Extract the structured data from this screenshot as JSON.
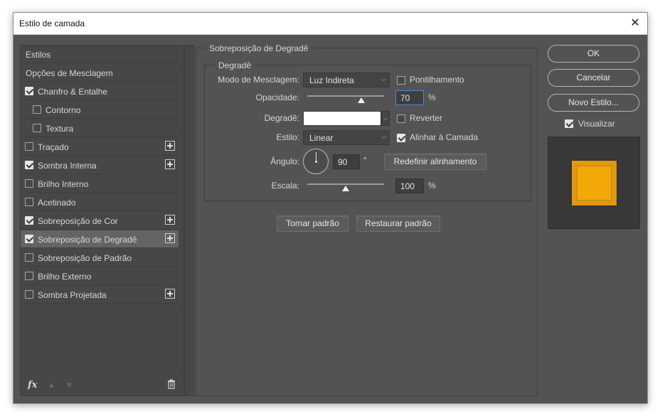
{
  "window": {
    "title": "Estilo de camada",
    "close_icon": "close-icon"
  },
  "sidebar": {
    "items": [
      {
        "label": "Estilos",
        "checkbox": null,
        "checked": false,
        "plus": false,
        "indent": false,
        "selected": false
      },
      {
        "label": "Opções de Mesclagem",
        "checkbox": null,
        "checked": false,
        "plus": false,
        "indent": false,
        "selected": false
      },
      {
        "label": "Chanfro & Entalhe",
        "checkbox": true,
        "checked": true,
        "plus": false,
        "indent": false,
        "selected": false
      },
      {
        "label": "Contorno",
        "checkbox": true,
        "checked": false,
        "plus": false,
        "indent": true,
        "selected": false
      },
      {
        "label": "Textura",
        "checkbox": true,
        "checked": false,
        "plus": false,
        "indent": true,
        "selected": false
      },
      {
        "label": "Traçado",
        "checkbox": true,
        "checked": false,
        "plus": true,
        "indent": false,
        "selected": false
      },
      {
        "label": "Sombra Interna",
        "checkbox": true,
        "checked": true,
        "plus": true,
        "indent": false,
        "selected": false
      },
      {
        "label": "Brilho Interno",
        "checkbox": true,
        "checked": false,
        "plus": false,
        "indent": false,
        "selected": false
      },
      {
        "label": "Acetinado",
        "checkbox": true,
        "checked": false,
        "plus": false,
        "indent": false,
        "selected": false
      },
      {
        "label": "Sobreposição de Cor",
        "checkbox": true,
        "checked": true,
        "plus": true,
        "indent": false,
        "selected": false
      },
      {
        "label": "Sobreposição de Degradê",
        "checkbox": true,
        "checked": true,
        "plus": true,
        "indent": false,
        "selected": true
      },
      {
        "label": "Sobreposição de Padrão",
        "checkbox": true,
        "checked": false,
        "plus": false,
        "indent": false,
        "selected": false
      },
      {
        "label": "Brilho Externo",
        "checkbox": true,
        "checked": false,
        "plus": false,
        "indent": false,
        "selected": false
      },
      {
        "label": "Sombra Projetada",
        "checkbox": true,
        "checked": false,
        "plus": true,
        "indent": false,
        "selected": false
      }
    ],
    "footer_icons": [
      "fx-icon",
      "move-up-icon",
      "move-down-icon",
      "trash-icon"
    ],
    "fx_label": "fx"
  },
  "panel": {
    "group_title": "Sobreposição de Degradê",
    "subgroup_title": "Degradê",
    "blend_mode_label": "Modo de Mesclagem:",
    "blend_mode_value": "Luz Indireta",
    "dither_label": "Pontilhamento",
    "dither_checked": false,
    "opacity_label": "Opacidade:",
    "opacity_value": "70",
    "opacity_fraction": 0.7,
    "percent": "%",
    "gradient_label": "Degradê:",
    "reverse_label": "Reverter",
    "reverse_checked": false,
    "style_label": "Estilo:",
    "style_value": "Linear",
    "align_label": "Alinhar à Camada",
    "align_checked": true,
    "angle_label": "Ângulo:",
    "angle_value": "90",
    "degree": "°",
    "reset_align_label": "Redefinir alinhamento",
    "scale_label": "Escala:",
    "scale_value": "100",
    "scale_fraction": 0.5,
    "make_default_label": "Tornar padrão",
    "reset_default_label": "Restaurar padrão"
  },
  "right": {
    "ok_label": "OK",
    "cancel_label": "Cancelar",
    "new_style_label": "Novo Estilo...",
    "preview_label": "Visualizar",
    "preview_checked": true,
    "preview_color": "#f2a805"
  }
}
